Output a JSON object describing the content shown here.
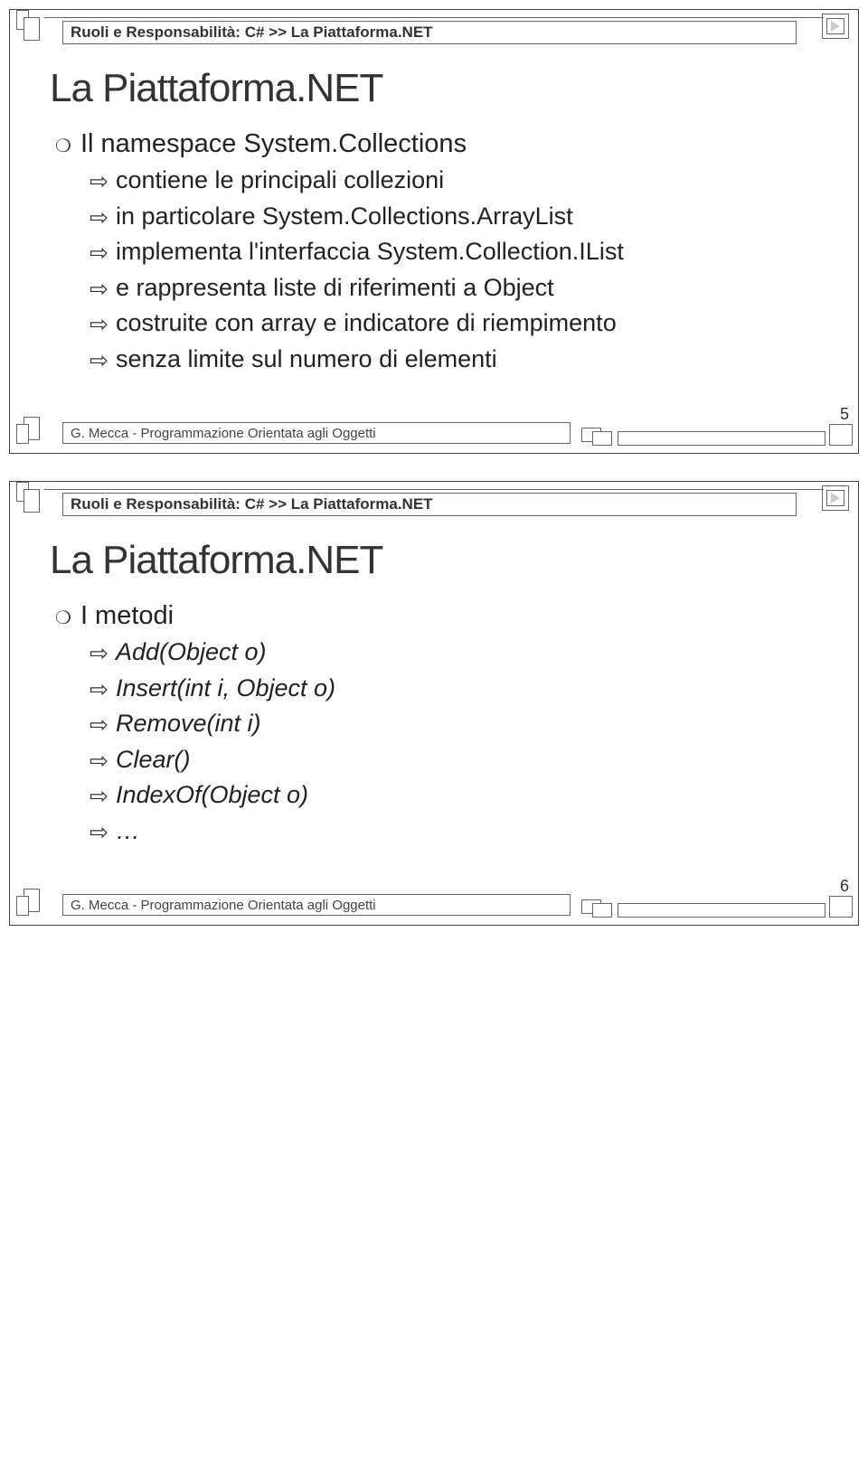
{
  "slide1": {
    "breadcrumb": "Ruoli e Responsabilità: C# >> La Piattaforma.NET",
    "title": "La Piattaforma.NET",
    "topic": "Il namespace System.Collections",
    "subs": [
      "contiene le principali collezioni",
      "in particolare System.Collections.ArrayList",
      "implementa l'interfaccia System.Collection.IList",
      "e rappresenta liste di riferimenti a Object",
      "costruite con array e indicatore di riempimento",
      "senza limite sul numero di elementi"
    ],
    "footer": "G. Mecca - Programmazione Orientata agli Oggetti",
    "page": "5"
  },
  "slide2": {
    "breadcrumb": "Ruoli e Responsabilità: C# >> La Piattaforma.NET",
    "title": "La Piattaforma.NET",
    "topic": "I metodi",
    "subs": [
      "Add(Object o)",
      "Insert(int i, Object o)",
      "Remove(int i)",
      "Clear()",
      "IndexOf(Object o)",
      "…"
    ],
    "footer": "G. Mecca - Programmazione Orientata agli Oggetti",
    "page": "6"
  }
}
